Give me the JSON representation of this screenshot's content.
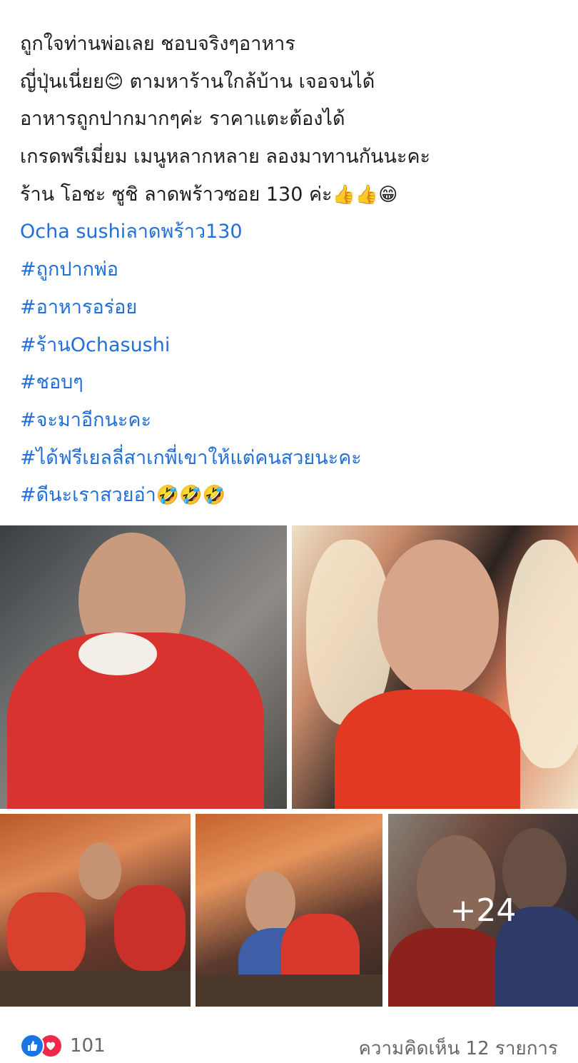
{
  "post": {
    "lines": [
      {
        "text": "ถูกใจท่านพ่อเลย ชอบจริงๆอาหาร",
        "emoji": ""
      },
      {
        "text": "ญี่ปุ่นเนี่ยย",
        "emoji": "😊",
        "after": " ตามหาร้านใกล้บ้าน เจอจนได้"
      },
      {
        "text": " อาหารถูกปากมากๆค่ะ ราคาแตะต้องได้",
        "emoji": ""
      },
      {
        "text": "เกรดพรีเมี่ยม เมนูหลากหลาย ลองมาทานกันนะคะ",
        "emoji": ""
      },
      {
        "text": "ร้าน โอชะ ซูชิ ลาดพร้าวซอย 130 ค่ะ",
        "emoji": "👍👍😁"
      }
    ],
    "place_link": "Ocha sushiลาดพร้าว130",
    "hashtags": [
      "#ถูกปากพ่อ",
      "#อาหารอร่อย",
      "#ร้านOchasushi",
      "#ชอบๆ",
      "#จะมาอีกนะคะ",
      "#ได้ฟรีเยลลี่สาเกพี่เขาให้แต่คนสวยนะคะ",
      "#ดีนะเราสวยอ่า"
    ],
    "last_hashtag_emoji": "🤣🤣🤣"
  },
  "photos": {
    "more_count": "+24"
  },
  "footer": {
    "reaction_count": "101",
    "comments_label": "ความคิดเห็น 12 รายการ"
  },
  "colors": {
    "link": "#216fdb",
    "like": "#1b74e4",
    "love": "#f0284a",
    "muted": "#65676b"
  }
}
